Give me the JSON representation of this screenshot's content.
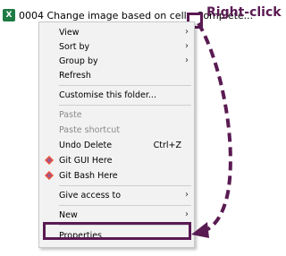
{
  "file": {
    "icon": "excel-icon",
    "icon_glyph": "X",
    "name": "0004 Change image based on cell - Complete..."
  },
  "annotation": {
    "text": "Right-click",
    "color": "#5a1a52"
  },
  "menu": {
    "items": [
      {
        "label": "View",
        "submenu": true
      },
      {
        "label": "Sort by",
        "submenu": true
      },
      {
        "label": "Group by",
        "submenu": true
      },
      {
        "label": "Refresh"
      },
      {
        "label": "Customise this folder..."
      },
      {
        "label": "Paste",
        "disabled": true
      },
      {
        "label": "Paste shortcut",
        "disabled": true
      },
      {
        "label": "Undo Delete",
        "shortcut": "Ctrl+Z"
      },
      {
        "label": "Git GUI Here",
        "icon": "git-icon"
      },
      {
        "label": "Git Bash Here",
        "icon": "git-icon"
      },
      {
        "label": "Give access to",
        "submenu": true
      },
      {
        "label": "New",
        "submenu": true
      },
      {
        "label": "Properties",
        "highlighted": true
      }
    ],
    "submenu_arrow": "›"
  }
}
